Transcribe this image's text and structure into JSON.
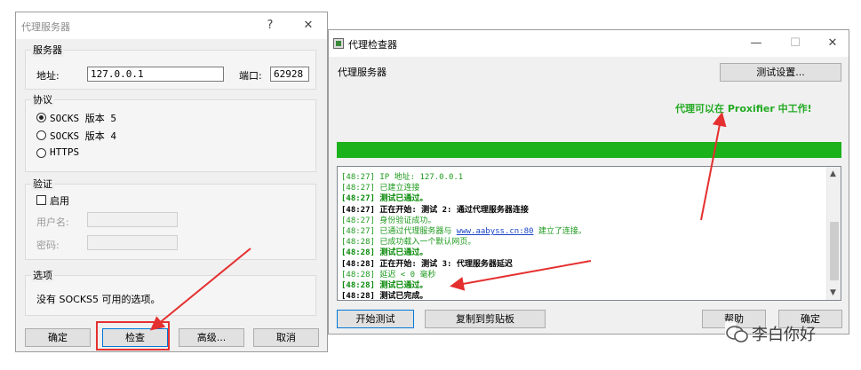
{
  "left_window": {
    "title": "代理服务器",
    "help_glyph": "?",
    "close_glyph": "✕",
    "server_group": {
      "label": "服务器",
      "address_label": "地址:",
      "address_value": "127.0.0.1",
      "port_label": "端口:",
      "port_value": "62928"
    },
    "protocol_group": {
      "label": "协议",
      "options": [
        "SOCKS 版本 5",
        "SOCKS 版本 4",
        "HTTPS"
      ],
      "selected": "SOCKS 版本 5"
    },
    "auth_group": {
      "label": "验证",
      "enable_label": "启用",
      "username_label": "用户名:",
      "password_label": "密码:"
    },
    "options_group": {
      "label": "选项",
      "text": "没有 SOCKS5 可用的选项。"
    },
    "buttons": {
      "ok": "确定",
      "check": "检查",
      "advanced": "高级...",
      "cancel": "取消"
    }
  },
  "right_window": {
    "title": "代理检查器",
    "minimize_glyph": "—",
    "maximize_glyph": "☐",
    "close_glyph": "✕",
    "section_label": "代理服务器",
    "test_settings_button": "测试设置...",
    "status_text": "代理可以在 Proxifier 中工作!",
    "progress": 1.0,
    "log": [
      {
        "parts": [
          {
            "t": "[48:27] IP 地址: 127.0.0.1",
            "c": "g"
          }
        ]
      },
      {
        "parts": [
          {
            "t": "[48:27] 已建立连接",
            "c": "g"
          }
        ]
      },
      {
        "parts": [
          {
            "t": "[48:27] 测试已通过。",
            "c": "gb"
          }
        ]
      },
      {
        "parts": [
          {
            "t": "[48:27] 正在开始: 测试 2: 通过代理服务器连接",
            "c": "k"
          }
        ]
      },
      {
        "parts": [
          {
            "t": "[48:27] 身份验证成功。",
            "c": "g"
          }
        ]
      },
      {
        "parts": [
          {
            "t": "[48:27] 已通过代理服务器与 ",
            "c": "g"
          },
          {
            "t": "www.aabyss.cn:80",
            "c": "link"
          },
          {
            "t": " 建立了连接。",
            "c": "g"
          }
        ]
      },
      {
        "parts": [
          {
            "t": "[48:28] 已成功载入一个默认网页。",
            "c": "g"
          }
        ]
      },
      {
        "parts": [
          {
            "t": "[48:28] 测试已通过。",
            "c": "gb"
          }
        ]
      },
      {
        "parts": [
          {
            "t": "[48:28] 正在开始: 测试 3: 代理服务器延迟",
            "c": "k"
          }
        ]
      },
      {
        "parts": [
          {
            "t": "[48:28] 延迟 < 0 毫秒",
            "c": "g"
          }
        ]
      },
      {
        "parts": [
          {
            "t": "[48:28] 测试已通过。",
            "c": "gb"
          }
        ]
      },
      {
        "parts": [
          {
            "t": "[48:28] 测试已完成。",
            "c": "k"
          }
        ]
      }
    ],
    "buttons": {
      "start_test": "开始测试",
      "copy_clipboard": "复制到剪贴板",
      "help": "帮助",
      "ok": "确定"
    }
  },
  "watermark": {
    "text": "李白你好",
    "icon": "wechat-icon"
  },
  "colors": {
    "progress": "#1bb21b",
    "status_text": "#22aa22",
    "annotation": "#e53030",
    "link": "#1a44c6"
  }
}
